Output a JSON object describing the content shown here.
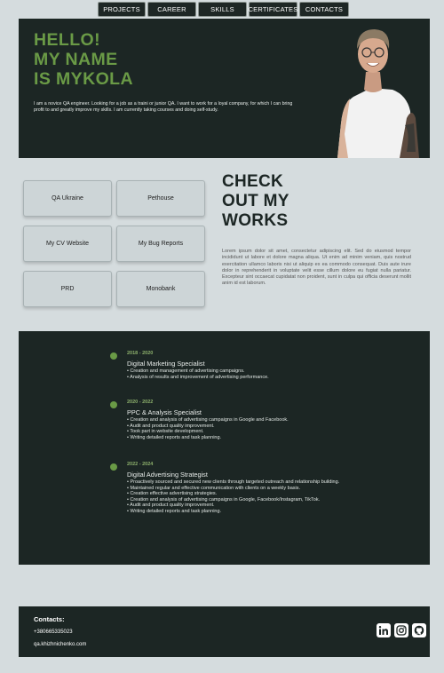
{
  "nav": {
    "items": [
      "PROJECTS",
      "CAREER",
      "SKILLS",
      "CERTIFICATES",
      "CONTACTS"
    ]
  },
  "hero": {
    "title_lines": [
      "HELLO!",
      "MY NAME",
      "IS MYKOLA"
    ],
    "description": "I am a novice QA engineer. Looking for a job as a traini or junior QA. I want to work for a loyal company, for which I can bring profit to and greatly improve my skills. I am currently taking courses and doing self-study."
  },
  "projects": {
    "buttons": [
      "QA Ukraine",
      "Pethouse",
      "My CV Website",
      "My Bug Reports",
      "PRD",
      "Monobank"
    ],
    "title_lines": [
      "CHECK",
      "OUT MY",
      "WORKS"
    ],
    "lorem": "Lorem ipsum dolor sit amet, consectetur adipiscing elit. Sed do eiusmod tempor incididunt ut labore et dolore magna aliqua. Ut enim ad minim veniam, quis nostrud exercitation ullamco laboris nisi ut aliquip ex ea commodo consequat. Duis aute irure dolor in reprehenderit in voluptate velit esse cillum dolore eu fugiat nulla pariatur. Excepteur sint occaecat cupidatat non proident, sunt in culpa qui officia deserunt mollit anim id est laborum."
  },
  "career": {
    "jobs": [
      {
        "years": "2018 - 2020",
        "title": "Digital Marketing Specialist",
        "items": [
          "• Creation and management of advertising campaigns.",
          "• Analysis of results and improvement of advertising performance."
        ]
      },
      {
        "years": "2020 - 2022",
        "title": "PPC & Analysis Specialist",
        "items": [
          "• Creation and analysis of advertising campaigns in Google and Facebook.",
          "• Audit and product quality improvement.",
          "• Took part in website development.",
          "• Writing detailed reports and task planning."
        ]
      },
      {
        "years": "2022 - 2024",
        "title": "Digital Advertising Strategist",
        "items": [
          "• Proactively sourced and secured new clients through targeted outreach and relationship building.",
          "• Maintained regular and effective communication with clients on a weekly basis.",
          "• Creation effective advertising strategies.",
          "• Creation and analysis of advertising campaigns in Google, Facebook/Instagram, TikTok.",
          "• Audit and product quality improvement.",
          "• Writing detailed reports and task planning."
        ]
      }
    ]
  },
  "contacts": {
    "heading": "Contacts:",
    "phone": "+380665335023",
    "email": "qa.khizhnichenko.com",
    "icons": [
      "linkedin-icon",
      "instagram-icon",
      "github-icon"
    ]
  },
  "colors": {
    "dark_bg": "#1c2624",
    "page_bg": "#d5dcde",
    "accent_green": "#6a9a46"
  }
}
